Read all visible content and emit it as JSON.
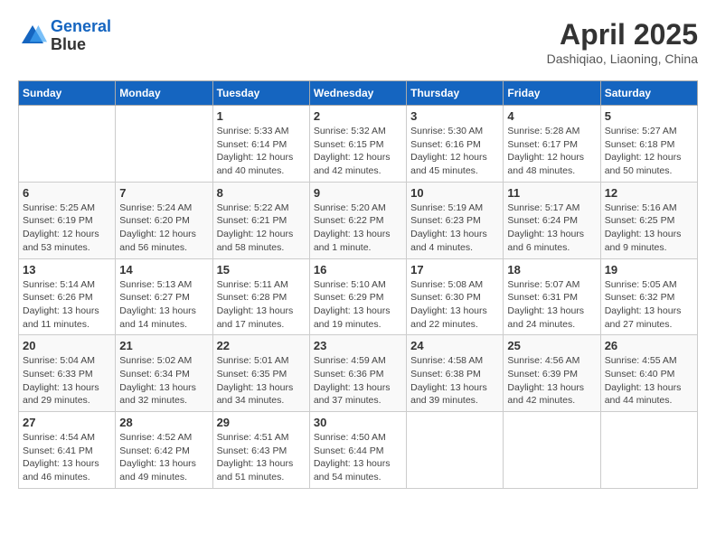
{
  "header": {
    "logo_line1": "General",
    "logo_line2": "Blue",
    "main_title": "April 2025",
    "subtitle": "Dashiqiao, Liaoning, China"
  },
  "calendar": {
    "days_of_week": [
      "Sunday",
      "Monday",
      "Tuesday",
      "Wednesday",
      "Thursday",
      "Friday",
      "Saturday"
    ],
    "weeks": [
      [
        {
          "day": "",
          "sunrise": "",
          "sunset": "",
          "daylight": ""
        },
        {
          "day": "",
          "sunrise": "",
          "sunset": "",
          "daylight": ""
        },
        {
          "day": "1",
          "sunrise": "Sunrise: 5:33 AM",
          "sunset": "Sunset: 6:14 PM",
          "daylight": "Daylight: 12 hours and 40 minutes."
        },
        {
          "day": "2",
          "sunrise": "Sunrise: 5:32 AM",
          "sunset": "Sunset: 6:15 PM",
          "daylight": "Daylight: 12 hours and 42 minutes."
        },
        {
          "day": "3",
          "sunrise": "Sunrise: 5:30 AM",
          "sunset": "Sunset: 6:16 PM",
          "daylight": "Daylight: 12 hours and 45 minutes."
        },
        {
          "day": "4",
          "sunrise": "Sunrise: 5:28 AM",
          "sunset": "Sunset: 6:17 PM",
          "daylight": "Daylight: 12 hours and 48 minutes."
        },
        {
          "day": "5",
          "sunrise": "Sunrise: 5:27 AM",
          "sunset": "Sunset: 6:18 PM",
          "daylight": "Daylight: 12 hours and 50 minutes."
        }
      ],
      [
        {
          "day": "6",
          "sunrise": "Sunrise: 5:25 AM",
          "sunset": "Sunset: 6:19 PM",
          "daylight": "Daylight: 12 hours and 53 minutes."
        },
        {
          "day": "7",
          "sunrise": "Sunrise: 5:24 AM",
          "sunset": "Sunset: 6:20 PM",
          "daylight": "Daylight: 12 hours and 56 minutes."
        },
        {
          "day": "8",
          "sunrise": "Sunrise: 5:22 AM",
          "sunset": "Sunset: 6:21 PM",
          "daylight": "Daylight: 12 hours and 58 minutes."
        },
        {
          "day": "9",
          "sunrise": "Sunrise: 5:20 AM",
          "sunset": "Sunset: 6:22 PM",
          "daylight": "Daylight: 13 hours and 1 minute."
        },
        {
          "day": "10",
          "sunrise": "Sunrise: 5:19 AM",
          "sunset": "Sunset: 6:23 PM",
          "daylight": "Daylight: 13 hours and 4 minutes."
        },
        {
          "day": "11",
          "sunrise": "Sunrise: 5:17 AM",
          "sunset": "Sunset: 6:24 PM",
          "daylight": "Daylight: 13 hours and 6 minutes."
        },
        {
          "day": "12",
          "sunrise": "Sunrise: 5:16 AM",
          "sunset": "Sunset: 6:25 PM",
          "daylight": "Daylight: 13 hours and 9 minutes."
        }
      ],
      [
        {
          "day": "13",
          "sunrise": "Sunrise: 5:14 AM",
          "sunset": "Sunset: 6:26 PM",
          "daylight": "Daylight: 13 hours and 11 minutes."
        },
        {
          "day": "14",
          "sunrise": "Sunrise: 5:13 AM",
          "sunset": "Sunset: 6:27 PM",
          "daylight": "Daylight: 13 hours and 14 minutes."
        },
        {
          "day": "15",
          "sunrise": "Sunrise: 5:11 AM",
          "sunset": "Sunset: 6:28 PM",
          "daylight": "Daylight: 13 hours and 17 minutes."
        },
        {
          "day": "16",
          "sunrise": "Sunrise: 5:10 AM",
          "sunset": "Sunset: 6:29 PM",
          "daylight": "Daylight: 13 hours and 19 minutes."
        },
        {
          "day": "17",
          "sunrise": "Sunrise: 5:08 AM",
          "sunset": "Sunset: 6:30 PM",
          "daylight": "Daylight: 13 hours and 22 minutes."
        },
        {
          "day": "18",
          "sunrise": "Sunrise: 5:07 AM",
          "sunset": "Sunset: 6:31 PM",
          "daylight": "Daylight: 13 hours and 24 minutes."
        },
        {
          "day": "19",
          "sunrise": "Sunrise: 5:05 AM",
          "sunset": "Sunset: 6:32 PM",
          "daylight": "Daylight: 13 hours and 27 minutes."
        }
      ],
      [
        {
          "day": "20",
          "sunrise": "Sunrise: 5:04 AM",
          "sunset": "Sunset: 6:33 PM",
          "daylight": "Daylight: 13 hours and 29 minutes."
        },
        {
          "day": "21",
          "sunrise": "Sunrise: 5:02 AM",
          "sunset": "Sunset: 6:34 PM",
          "daylight": "Daylight: 13 hours and 32 minutes."
        },
        {
          "day": "22",
          "sunrise": "Sunrise: 5:01 AM",
          "sunset": "Sunset: 6:35 PM",
          "daylight": "Daylight: 13 hours and 34 minutes."
        },
        {
          "day": "23",
          "sunrise": "Sunrise: 4:59 AM",
          "sunset": "Sunset: 6:36 PM",
          "daylight": "Daylight: 13 hours and 37 minutes."
        },
        {
          "day": "24",
          "sunrise": "Sunrise: 4:58 AM",
          "sunset": "Sunset: 6:38 PM",
          "daylight": "Daylight: 13 hours and 39 minutes."
        },
        {
          "day": "25",
          "sunrise": "Sunrise: 4:56 AM",
          "sunset": "Sunset: 6:39 PM",
          "daylight": "Daylight: 13 hours and 42 minutes."
        },
        {
          "day": "26",
          "sunrise": "Sunrise: 4:55 AM",
          "sunset": "Sunset: 6:40 PM",
          "daylight": "Daylight: 13 hours and 44 minutes."
        }
      ],
      [
        {
          "day": "27",
          "sunrise": "Sunrise: 4:54 AM",
          "sunset": "Sunset: 6:41 PM",
          "daylight": "Daylight: 13 hours and 46 minutes."
        },
        {
          "day": "28",
          "sunrise": "Sunrise: 4:52 AM",
          "sunset": "Sunset: 6:42 PM",
          "daylight": "Daylight: 13 hours and 49 minutes."
        },
        {
          "day": "29",
          "sunrise": "Sunrise: 4:51 AM",
          "sunset": "Sunset: 6:43 PM",
          "daylight": "Daylight: 13 hours and 51 minutes."
        },
        {
          "day": "30",
          "sunrise": "Sunrise: 4:50 AM",
          "sunset": "Sunset: 6:44 PM",
          "daylight": "Daylight: 13 hours and 54 minutes."
        },
        {
          "day": "",
          "sunrise": "",
          "sunset": "",
          "daylight": ""
        },
        {
          "day": "",
          "sunrise": "",
          "sunset": "",
          "daylight": ""
        },
        {
          "day": "",
          "sunrise": "",
          "sunset": "",
          "daylight": ""
        }
      ]
    ]
  }
}
